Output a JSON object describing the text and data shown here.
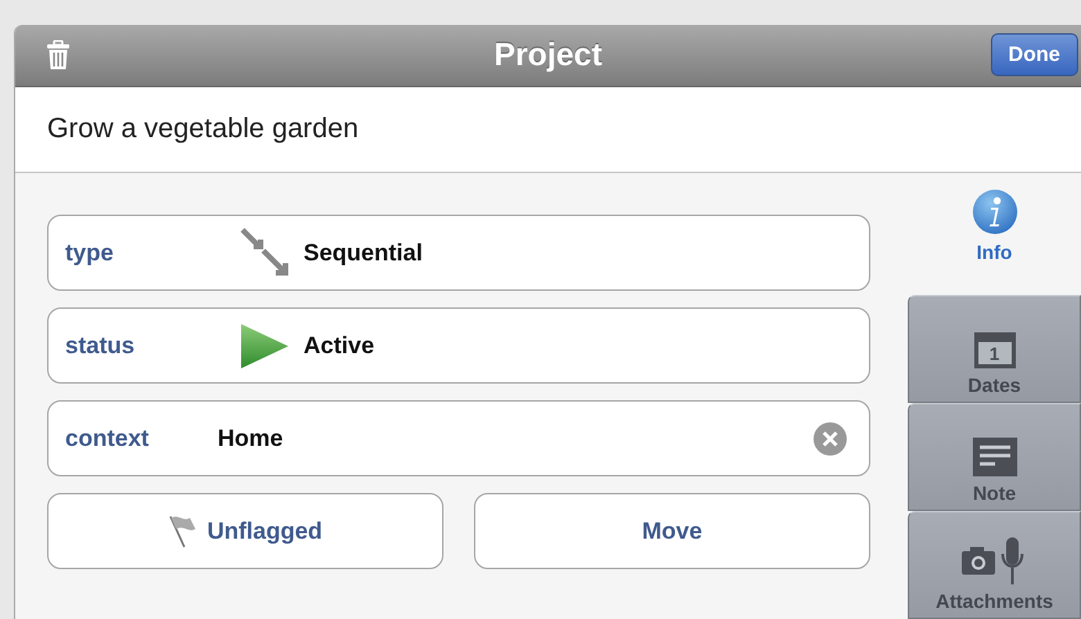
{
  "window": {
    "title": "Project"
  },
  "buttons": {
    "done": "Done"
  },
  "project_name": "Grow a vegetable garden",
  "fields": [
    {
      "kind": "type",
      "label": "type",
      "value": "Sequential"
    },
    {
      "kind": "status",
      "label": "status",
      "value": "Active"
    },
    {
      "kind": "context",
      "label": "context",
      "value": "Home"
    }
  ],
  "actions": [
    {
      "kind": "flag",
      "label": "Unflagged",
      "flagged": false
    },
    {
      "kind": "move",
      "label": "Move"
    }
  ],
  "tabs": [
    {
      "kind": "info",
      "label": "Info",
      "selected": true
    },
    {
      "kind": "dates",
      "label": "Dates",
      "selected": false,
      "icon_text": "1"
    },
    {
      "kind": "note",
      "label": "Note",
      "selected": false
    },
    {
      "kind": "attachments",
      "label": "Attachments",
      "selected": false
    }
  ]
}
